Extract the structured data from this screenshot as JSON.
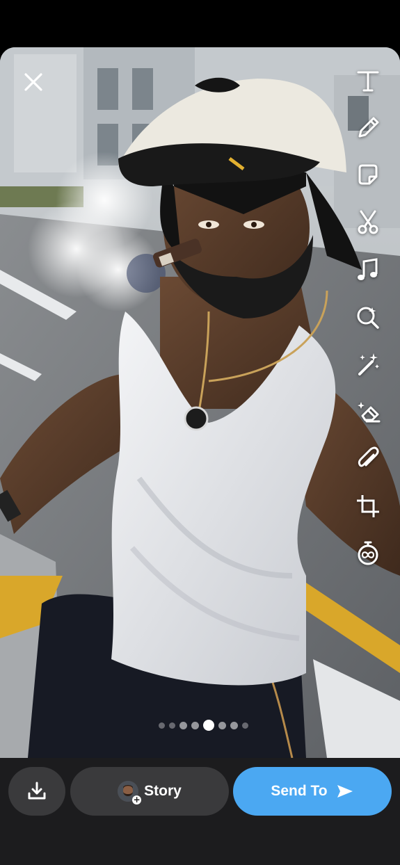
{
  "photo": {
    "description_icon": "anime-portrait-photo"
  },
  "top": {
    "close_icon": "close-icon"
  },
  "toolbar": {
    "tools": [
      {
        "name": "text-tool",
        "icon": "text-icon"
      },
      {
        "name": "draw-tool",
        "icon": "pencil-icon"
      },
      {
        "name": "sticker-tool",
        "icon": "sticker-icon"
      },
      {
        "name": "scissors-tool",
        "icon": "scissors-icon"
      },
      {
        "name": "music-tool",
        "icon": "music-note-icon"
      },
      {
        "name": "lens-tool",
        "icon": "lens-search-icon"
      },
      {
        "name": "magic-tool",
        "icon": "magic-wand-icon"
      },
      {
        "name": "eraser-tool",
        "icon": "magic-eraser-icon"
      },
      {
        "name": "attachment-tool",
        "icon": "paperclip-icon"
      },
      {
        "name": "crop-tool",
        "icon": "crop-icon"
      },
      {
        "name": "timer-tool",
        "icon": "timer-icon"
      }
    ]
  },
  "pager": {
    "count": 8,
    "active_index": 3
  },
  "bottom": {
    "save_icon": "download-icon",
    "story_label": "Story",
    "send_label": "Send To",
    "colors": {
      "bar": "#1c1c1e",
      "pill": "#3a3a3c",
      "send": "#4ba8f2"
    }
  }
}
